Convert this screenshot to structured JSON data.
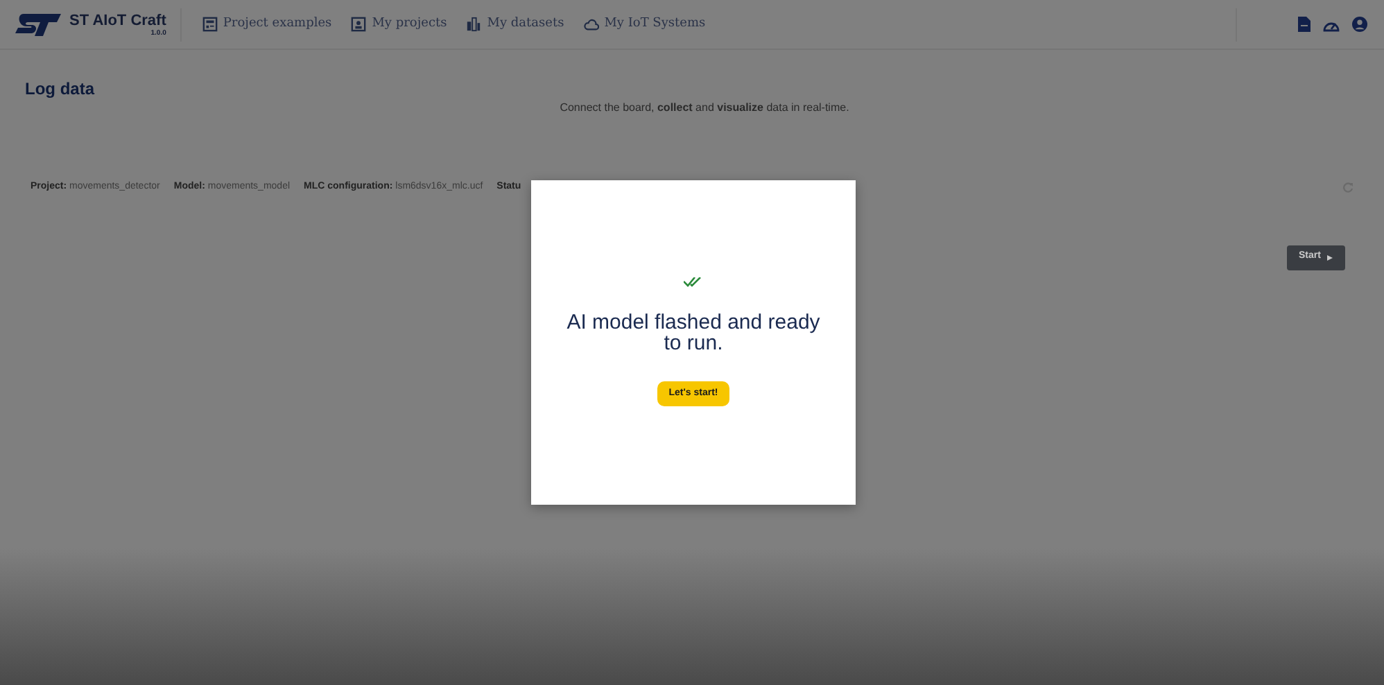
{
  "header": {
    "brand": "ST AIoT Craft",
    "version": "1.0.0",
    "nav": [
      {
        "label": "Project examples",
        "kind": "examples"
      },
      {
        "label": "My projects",
        "kind": "projects"
      },
      {
        "label": "My datasets",
        "kind": "datasets"
      },
      {
        "label": "My IoT Systems",
        "kind": "cloud"
      }
    ]
  },
  "page": {
    "title": "Log data",
    "subtitle": "Connect the board, **collect** and **visualize** data in real-time.",
    "details": [
      {
        "label": "Project:",
        "value": "movements_detector"
      },
      {
        "label": "Model:",
        "value": "movements_model"
      },
      {
        "label": "MLC configuration:",
        "value": "lsm6dsv16x_mlc.ucf"
      },
      {
        "label": "Statu"
      }
    ],
    "start_button": "Start"
  },
  "dialog": {
    "message": "AI model flashed and ready to run.",
    "button": "Let's start!"
  }
}
